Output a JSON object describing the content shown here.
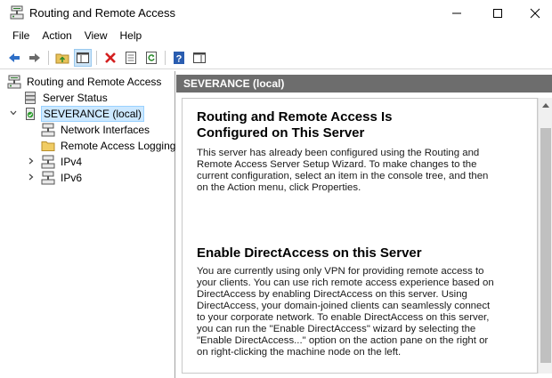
{
  "window": {
    "title": "Routing and Remote Access",
    "icon": "routing-server-icon"
  },
  "menu": [
    "File",
    "Action",
    "View",
    "Help"
  ],
  "toolbar": {
    "buttons": [
      "back-arrow-icon",
      "forward-arrow-icon",
      "up-folder-icon",
      "show-hide-tree-icon",
      "delete-icon",
      "properties-icon",
      "refresh-icon",
      "help-icon",
      "show-hide-action-pane-icon"
    ]
  },
  "tree": {
    "root": "Routing and Remote Access",
    "items": [
      {
        "label": "Server Status",
        "icon": "server-status-icon"
      },
      {
        "label": "SEVERANCE (local)",
        "icon": "server-icon",
        "selected": true,
        "expanded": true
      },
      {
        "label": "Network Interfaces",
        "icon": "network-interface-icon"
      },
      {
        "label": "Remote Access Logging",
        "icon": "folder-icon"
      },
      {
        "label": "IPv4",
        "icon": "network-icon",
        "expandable": true
      },
      {
        "label": "IPv6",
        "icon": "network-icon",
        "expandable": true
      }
    ]
  },
  "right_pane": {
    "header": "SEVERANCE (local)",
    "section1": {
      "title_line1": "Routing and Remote Access Is",
      "title_line2": "Configured on This Server",
      "lines": [
        "This server has already been configured using the Routing and",
        "Remote Access Server Setup Wizard. To make changes to the",
        "current configuration, select an item in the console tree, and then",
        "on the Action menu, click Properties."
      ]
    },
    "section2": {
      "title": "Enable DirectAccess on this Server",
      "lines": [
        "You are currently using only VPN for providing remote access to",
        "your clients. You can use rich remote access experience based on",
        "DirectAccess by enabling DirectAccess on this server. Using",
        "DirectAccess, your domain-joined clients can seamlessly connect",
        "to your corporate network. To enable DirectAccess on this server,",
        "you can run the \"Enable DirectAccess\" wizard by selecting the",
        "\"Enable DirectAccess...\" option on the action pane on the right or",
        "on right-clicking the machine node on the left."
      ]
    }
  },
  "colors": {
    "header_bg": "#6d6d6d",
    "selection_bg": "#cce8ff",
    "delete_red": "#d42020",
    "help_blue": "#2a5db0"
  }
}
